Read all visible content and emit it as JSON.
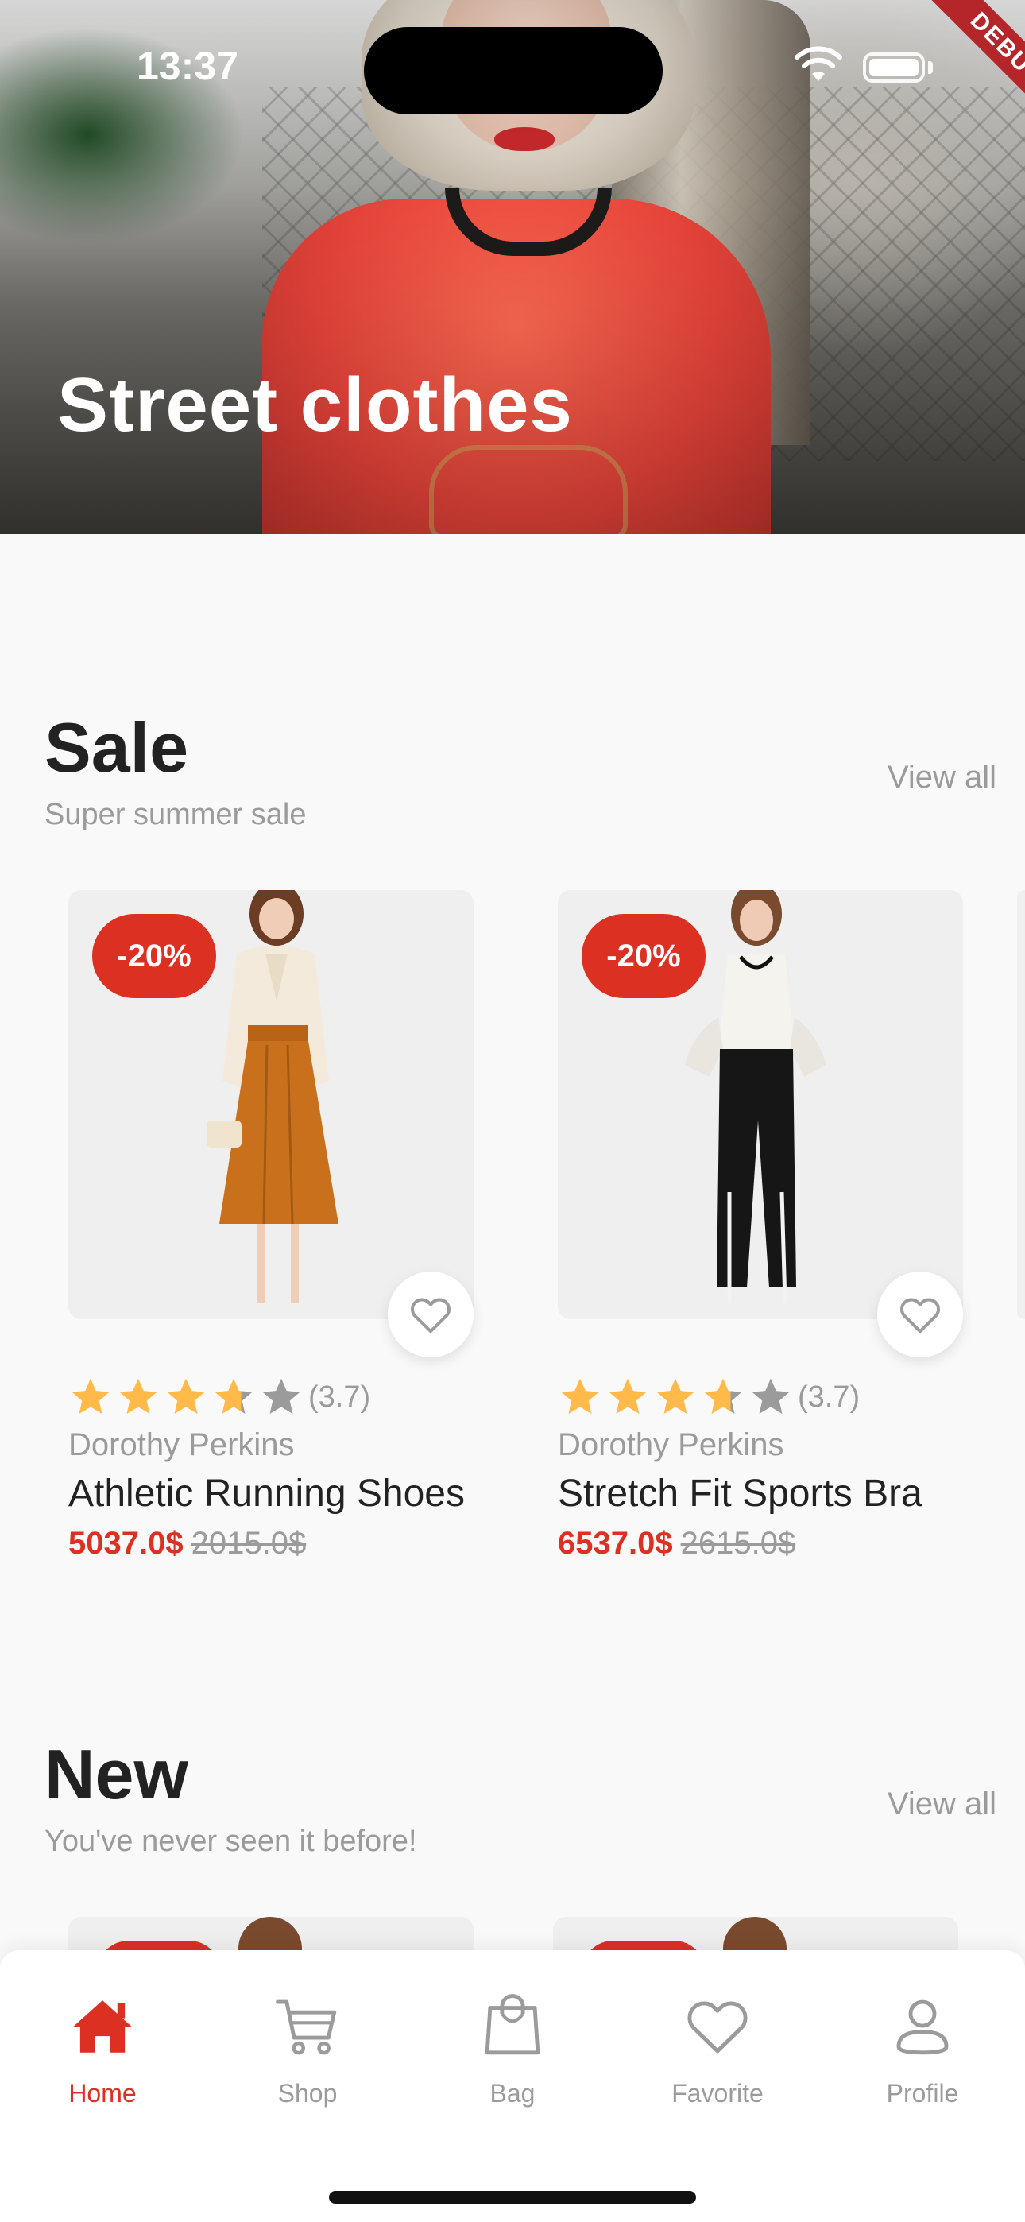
{
  "status_bar": {
    "time": "13:37",
    "debug_label": "DEBUG"
  },
  "hero": {
    "title": "Street clothes"
  },
  "sale": {
    "title": "Sale",
    "subtitle": "Super summer sale",
    "view_all": "View all",
    "products": [
      {
        "discount": "-20%",
        "rating": 3.7,
        "rating_text": "(3.7)",
        "brand": "Dorothy Perkins",
        "name": "Athletic Running Shoes",
        "price": "5037.0$",
        "old_price": "2015.0$"
      },
      {
        "discount": "-20%",
        "rating": 3.7,
        "rating_text": "(3.7)",
        "brand": "Dorothy Perkins",
        "name": "Stretch Fit Sports Bra",
        "price": "6537.0$",
        "old_price": "2615.0$"
      }
    ]
  },
  "new": {
    "title": "New",
    "subtitle": "You've never seen it before!",
    "view_all": "View all"
  },
  "nav": {
    "items": [
      {
        "label": "Home",
        "icon": "home-icon",
        "active": true
      },
      {
        "label": "Shop",
        "icon": "cart-icon",
        "active": false
      },
      {
        "label": "Bag",
        "icon": "bag-icon",
        "active": false
      },
      {
        "label": "Favorite",
        "icon": "heart-icon",
        "active": false
      },
      {
        "label": "Profile",
        "icon": "person-icon",
        "active": false
      }
    ]
  },
  "colors": {
    "accent": "#DB3022",
    "star": "#FFBA49",
    "star_empty": "#9B9B9B",
    "muted_text": "#9B9B9B"
  }
}
